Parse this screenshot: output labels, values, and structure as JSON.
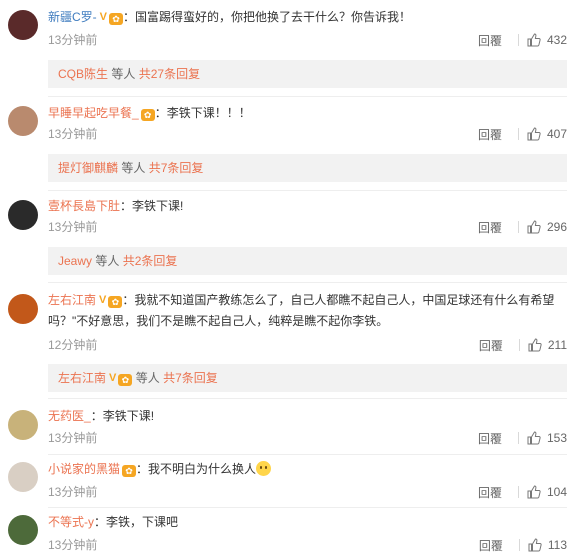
{
  "comments": [
    {
      "user": "新疆C罗-",
      "has_v": true,
      "has_emblem": true,
      "text": "：国富踢得蛮好的，你把他换了去干什么？你告诉我！",
      "time": "13分钟前",
      "reply_label": "回覆",
      "likes": "432",
      "sub": {
        "name": "CQB陈生",
        "mid": "等人",
        "count": "共27条回复"
      },
      "avatar_color": "#5a2a2a"
    },
    {
      "user": "早睡早起吃早餐_",
      "has_v": false,
      "has_emblem": true,
      "text": "：李铁下课！！！",
      "time": "13分钟前",
      "reply_label": "回覆",
      "likes": "407",
      "sub": {
        "name": "提灯御麒麟",
        "mid": "等人",
        "count": "共7条回复"
      },
      "avatar_color": "#b98a6e"
    },
    {
      "user": "壹杯長島下肚",
      "has_v": false,
      "has_emblem": false,
      "text": "：李铁下课!",
      "time": "13分钟前",
      "reply_label": "回覆",
      "likes": "296",
      "sub": {
        "name": "Jeawy",
        "mid": "等人",
        "count": "共2条回复"
      },
      "avatar_color": "#2a2a2a"
    },
    {
      "user": "左右江南",
      "has_v": true,
      "has_emblem": true,
      "text": "：我就不知道国产教练怎么了，自己人都瞧不起自己人，中国足球还有什么有希望吗？\"不好意思，我们不是瞧不起自己人，纯粹是瞧不起你李铁。",
      "time": "12分钟前",
      "reply_label": "回覆",
      "likes": "211",
      "sub": {
        "name": "左右江南",
        "mid": "等人",
        "count": "共7条回复"
      },
      "avatar_color": "#c2581a"
    },
    {
      "user": "无药医_",
      "has_v": false,
      "has_emblem": false,
      "text": "：李铁下课!",
      "time": "13分钟前",
      "reply_label": "回覆",
      "likes": "153",
      "avatar_color": "#c8b27a"
    },
    {
      "user": "小说家的黑猫",
      "has_v": false,
      "has_emblem": true,
      "text": "：我不明白为什么换人",
      "time": "13分钟前",
      "reply_label": "回覆",
      "likes": "104",
      "avatar_color": "#d9cfc4"
    },
    {
      "user": "不等式-y",
      "has_v": false,
      "has_emblem": false,
      "text": "：李铁，下课吧",
      "time": "13分钟前",
      "reply_label": "回覆",
      "likes": "113",
      "avatar_color": "#4d6a3a"
    }
  ]
}
